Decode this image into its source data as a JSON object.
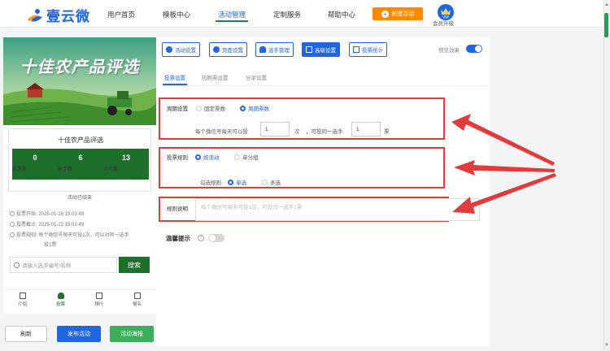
{
  "header": {
    "logo_text": "壹云微",
    "nav": [
      "用户首页",
      "模板中心",
      "活动管理",
      "定制服务",
      "帮助中心"
    ],
    "active_nav": "活动管理",
    "create_button": "创建活动",
    "vip_badge": "VIP",
    "vip_label": "会员升级"
  },
  "preview": {
    "banner_title": "十佳农产品评选",
    "card_title": "十佳农产品评选",
    "stats": [
      {
        "value": "0",
        "label": "总票数"
      },
      {
        "value": "6",
        "label": "选手数"
      },
      {
        "value": "13",
        "label": "访问量"
      }
    ],
    "status_text": "活动已结束",
    "info": [
      "投票开始: 2025-01-16 15:03:49",
      "投票截止: 2025-01-22 15:03:49",
      "投票规则: 每个微信号每天可投1次，可以对同一选手",
      "投1票"
    ],
    "search_placeholder": "请输入选手编号/名称",
    "search_button": "搜索",
    "tabs": [
      "介绍",
      "投票",
      "排行",
      "报名"
    ],
    "active_tab": "投票"
  },
  "bottom_buttons": {
    "refresh": "刷新",
    "publish": "发布活动",
    "poster": "活动海报"
  },
  "toolbar": {
    "buttons": [
      "活动设置",
      "页面设置",
      "选手管理",
      "高级设置",
      "投票统计"
    ],
    "active": "高级设置",
    "preview_label": "预览效果"
  },
  "subtabs": {
    "items": [
      "投票设置",
      "防刷票设置",
      "分享设置"
    ],
    "active": "投票设置"
  },
  "cycle": {
    "label": "周期设置",
    "options": [
      "固定票数",
      "周期票数"
    ],
    "selected": "周期票数",
    "text_before": "每个微信号每天可以投",
    "votes_value": "1",
    "unit_times": "次",
    "text_middle": "，可投同一选手",
    "same_value": "1",
    "unit_votes": "票"
  },
  "rule": {
    "label": "投票规则",
    "options": [
      "按活动",
      "单分组"
    ],
    "selected": "按活动",
    "check_label": "勾选规则",
    "check_options": [
      "单选",
      "多选"
    ],
    "check_selected": "单选"
  },
  "description": {
    "label": "规则说明",
    "placeholder": "每个微信号每天可投1次，可投同一选手1票"
  },
  "warning": {
    "label": "温馨提示"
  },
  "colors": {
    "brand": "#1f66e0",
    "orange": "#ff8a00",
    "green": "#1e6e2c",
    "red_annotation": "#e23b3b"
  }
}
